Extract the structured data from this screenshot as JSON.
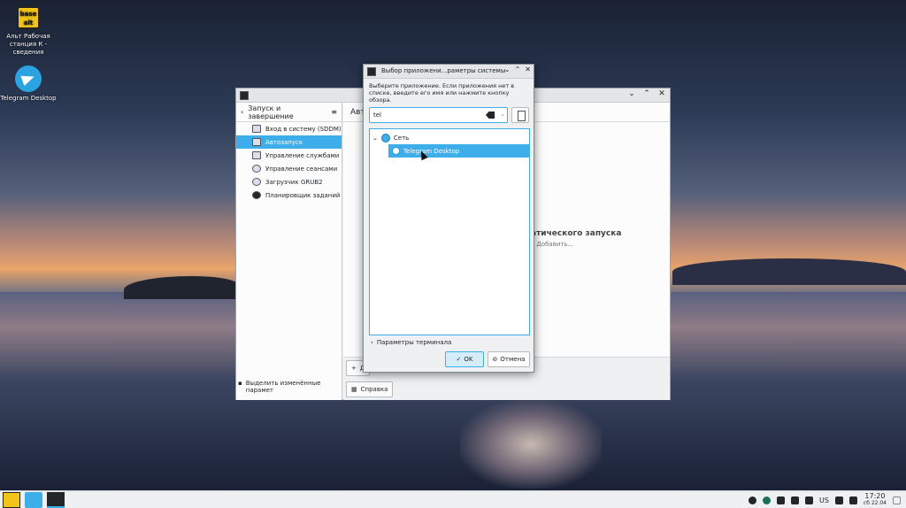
{
  "desktop": {
    "icons": [
      {
        "name": "basealt",
        "logo_text": "base alt",
        "label": "Альт Рабочая станция К - сведения"
      },
      {
        "name": "telegram",
        "label": "Telegram Desktop"
      }
    ]
  },
  "settings_window": {
    "back_label": "Запуск и завершение",
    "content_header": "Авто",
    "nav_items": [
      {
        "label": "Вход в систему (SDDM)",
        "active": false
      },
      {
        "label": "Автозапуск",
        "active": true
      },
      {
        "label": "Управление службами",
        "active": false
      },
      {
        "label": "Управление сеансами",
        "active": false
      },
      {
        "label": "Загрузчик GRUB2",
        "active": false
      },
      {
        "label": "Планировщик заданий",
        "active": false
      }
    ],
    "highlight_changes": "Выделить изменённые парамет",
    "empty_title": "атического запуска",
    "empty_sub": "у Добавить...",
    "add_button_label": "Д",
    "help_button_label": "Справка"
  },
  "dialog": {
    "title": "Выбор приложени...раметры системы",
    "message": "Выберите приложение. Если приложения нет в списке, введите его имя или нажмите кнопку обзора.",
    "search_value": "tel",
    "tree": [
      {
        "label": "Сеть",
        "level": 0,
        "expanded": true,
        "selected": false
      },
      {
        "label": "Telegram Desktop",
        "level": 1,
        "expanded": false,
        "selected": true
      }
    ],
    "terminal_options": "Параметры терминала",
    "ok": "OK",
    "cancel": "Отмена"
  },
  "taskbar": {
    "keyboard_layout": "US",
    "time": "17:20",
    "date": "сб 22.04"
  }
}
